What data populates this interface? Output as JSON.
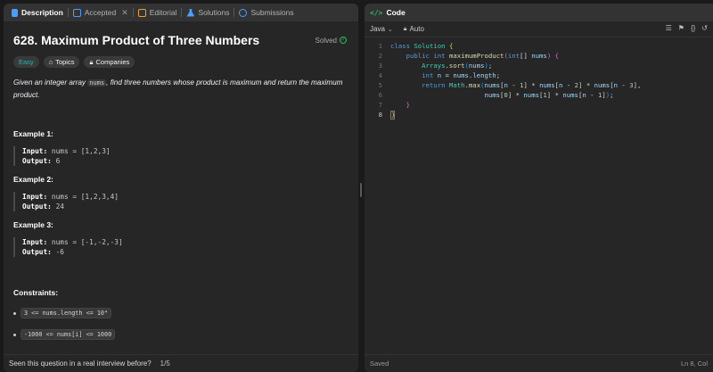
{
  "tabs": [
    {
      "label": "Description",
      "icon": "document-icon",
      "active": true
    },
    {
      "label": "Accepted",
      "icon": "accepted-icon",
      "active": false
    },
    {
      "label": "Editorial",
      "icon": "editorial-icon",
      "active": false
    },
    {
      "label": "Solutions",
      "icon": "flask-icon",
      "active": false
    },
    {
      "label": "Submissions",
      "icon": "history-icon",
      "active": false
    }
  ],
  "problem": {
    "title": "628. Maximum Product of Three Numbers",
    "status": "Solved",
    "tags": [
      "Easy",
      "Topics",
      "Companies"
    ],
    "desc_before": "Given an integer array ",
    "desc_code": "nums",
    "desc_after": ", find three numbers whose product is maximum and return the maximum product.",
    "examples": [
      {
        "title": "Example 1:",
        "input_label": "Input:",
        "input": "nums = [1,2,3]",
        "output_label": "Output:",
        "output": "6"
      },
      {
        "title": "Example 2:",
        "input_label": "Input:",
        "input": "nums = [1,2,3,4]",
        "output_label": "Output:",
        "output": "24"
      },
      {
        "title": "Example 3:",
        "input_label": "Input:",
        "input": "nums = [-1,-2,-3]",
        "output_label": "Output:",
        "output": "-6"
      }
    ],
    "constraints_title": "Constraints:",
    "constraints": [
      "3 <= nums.length <= 10⁴",
      "-1000 <= nums[i] <= 1000"
    ]
  },
  "footer": {
    "question": "Seen this question in a real interview before?",
    "page": "1/5"
  },
  "editor": {
    "header": "Code",
    "language": "Java",
    "mode": "Auto",
    "line_numbers": [
      "1",
      "2",
      "3",
      "4",
      "5",
      "6",
      "7",
      "8"
    ],
    "status_left": "Saved",
    "status_right": "Ln 8, Col"
  },
  "colors": {
    "accent_green": "#2cbb5d",
    "easy": "#1cb8b8",
    "keyword": "#569cd6"
  }
}
